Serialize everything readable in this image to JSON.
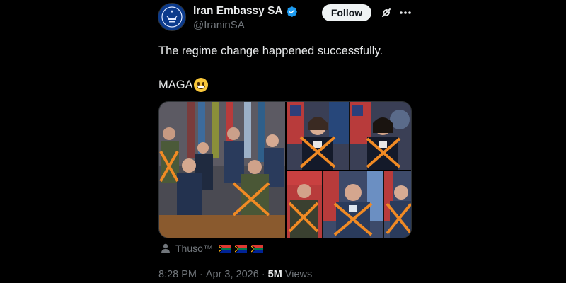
{
  "author": {
    "display_name": "Iran Embassy SA",
    "handle": "@IraninSA",
    "verified": true,
    "avatar_icon": "embassy-emblem-icon"
  },
  "actions": {
    "follow_label": "Follow",
    "grok_icon": "grok-icon",
    "more_icon": "more-options-icon"
  },
  "tweet": {
    "line1": "The regime change happened successfully.",
    "line2": "MAGA",
    "emoji": "grinning-face-emoji"
  },
  "media": {
    "photos": [
      {
        "name": "group-photo-generals",
        "crossed_out_count": 2
      },
      {
        "name": "portrait-admiral-1",
        "crossed_out_count": 1
      },
      {
        "name": "portrait-admiral-2",
        "crossed_out_count": 1
      },
      {
        "name": "portrait-general-army",
        "crossed_out_count": 1
      },
      {
        "name": "portrait-general-airforce",
        "crossed_out_count": 1
      },
      {
        "name": "portrait-officer-airforce",
        "crossed_out_count": 1
      }
    ],
    "mark_color": "#f08a24"
  },
  "attribution": {
    "label": "Thuso™",
    "flags": [
      "south-africa-flag",
      "south-africa-flag",
      "south-africa-flag"
    ]
  },
  "meta": {
    "time": "8:28 PM",
    "separator": "·",
    "date": "Apr 3, 2026",
    "views_count": "5M",
    "views_label": "Views"
  },
  "colors": {
    "background": "#000000",
    "text": "#e7e9ea",
    "muted": "#71767b",
    "verified": "#1d9bf0"
  }
}
